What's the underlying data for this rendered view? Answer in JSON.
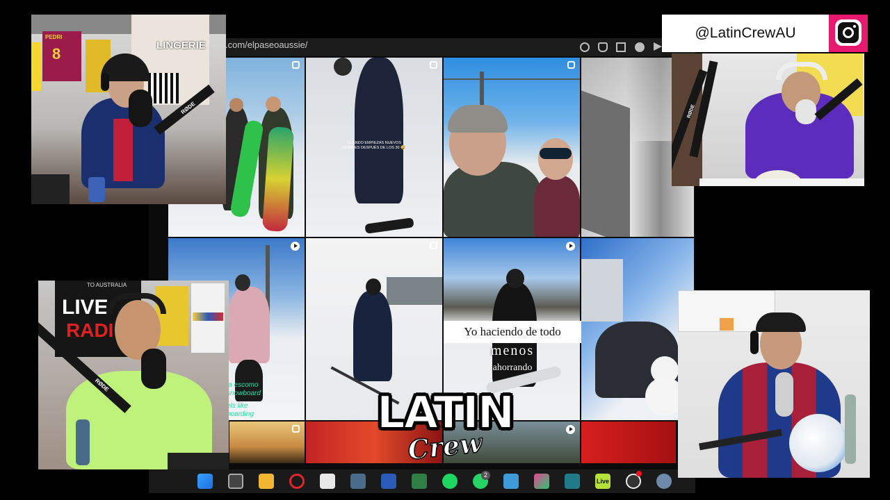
{
  "screen": {
    "url": ".com/elpaseoaussie/",
    "toolbar_icons": [
      "search-icon",
      "bell-icon",
      "crop-icon",
      "check-icon",
      "send-icon"
    ]
  },
  "grid": {
    "tile_badges": [
      "carousel",
      "carousel",
      "carousel",
      "none",
      "play",
      "carousel",
      "play",
      "none"
    ],
    "tile2_small_caption": "CUANDO EMPIEZAS NUEVOS\nHOBBIES DESPUÉS DE LOS 30 😅",
    "tile5_caption_lines": [
      "la escomo",
      "snowboard",
      "els like",
      "boarding"
    ],
    "tile7_caption_box": "Yo haciendo de todo",
    "tile7_caption_line2": "menos",
    "tile7_caption_line3": "ahorrando"
  },
  "handle": {
    "text": "@LatinCrewAU",
    "icon": "instagram-icon",
    "brand_color": "#e6196e"
  },
  "logo": {
    "line1": "LATIN",
    "line2": "Crew"
  },
  "webcams": {
    "top_left": {
      "banner": "LINGERIE",
      "jersey_number": "8",
      "jersey_name": "PEDRI",
      "mic_brand": "RØDE"
    },
    "bottom_left": {
      "banner_top": "TO AUSTRALIA",
      "banner_main": "LIVE",
      "banner_sub": "RADI",
      "mic_brand": "RØDE"
    },
    "top_right": {
      "mic_brand": "RØDE"
    },
    "bottom_right": {}
  },
  "taskbar": {
    "icons": [
      "windows-start-icon",
      "task-view-icon",
      "file-explorer-icon",
      "opera-icon",
      "snipping-tool-icon",
      "calculator-icon",
      "word-icon",
      "notepad-icon",
      "spotify-icon",
      "whatsapp-icon",
      "notes-icon",
      "paint-icon",
      "keyboard-icon",
      "live-icon",
      "obs-icon",
      "settings-icon"
    ],
    "whatsapp_badge": "2",
    "live_label": "Live"
  }
}
